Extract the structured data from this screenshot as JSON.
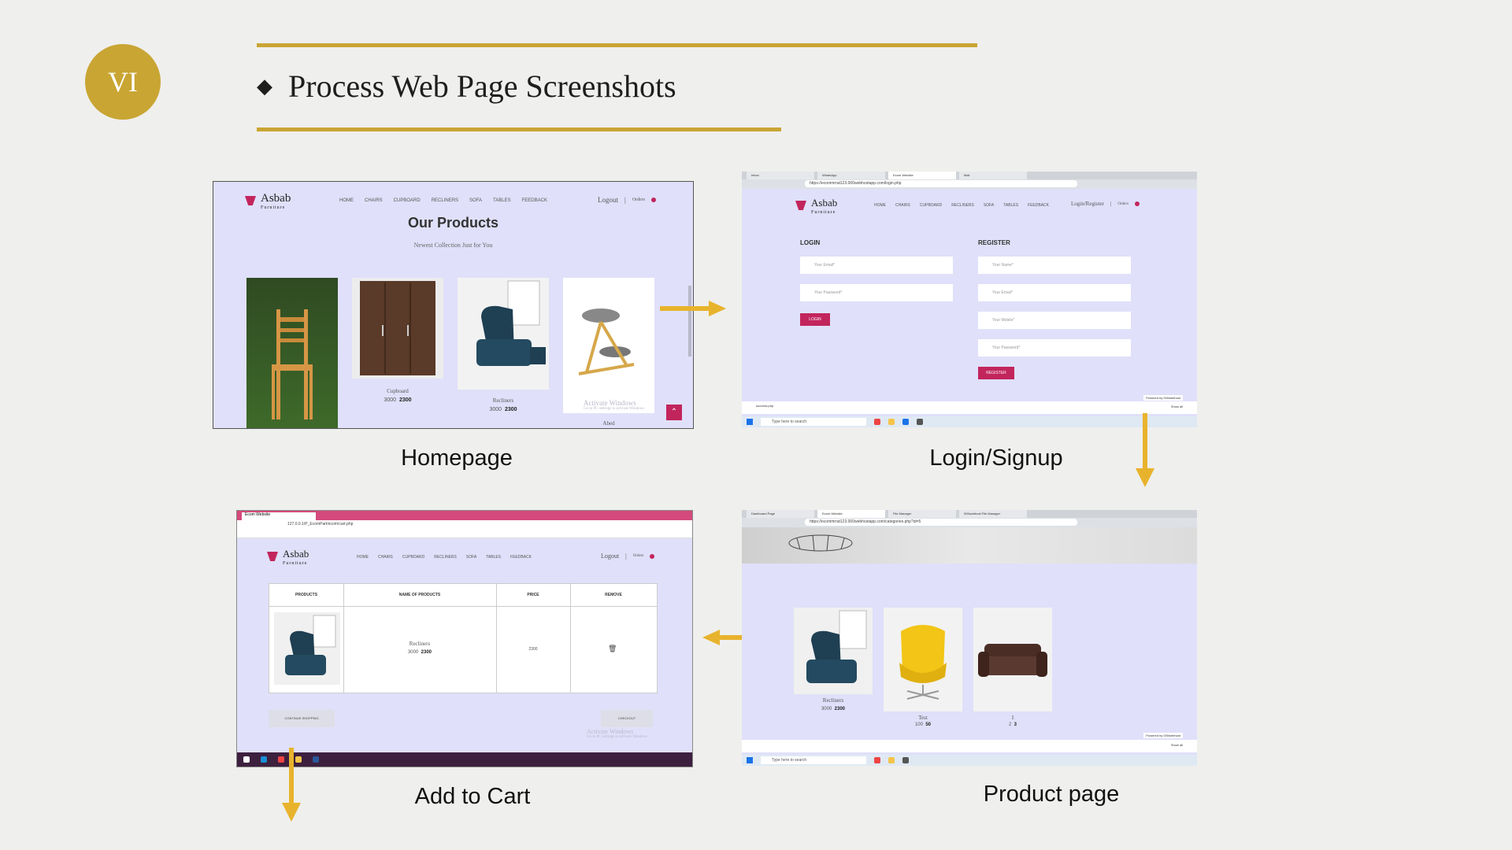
{
  "slide": {
    "badge": "VI",
    "title": "Process Web Page Screenshots",
    "accent_color": "#c9a533"
  },
  "captions": {
    "homepage": "Homepage",
    "login": "Login/Signup",
    "cart": "Add to Cart",
    "product": "Product page"
  },
  "site": {
    "logo": "Asbab",
    "logo_sub": "Furniture",
    "nav": [
      "HOME",
      "CHAIRS",
      "CUPBOARD",
      "RECLINERS",
      "SOFA",
      "TABLES",
      "FEEDBACK"
    ],
    "logout": "Logout",
    "orders": "Orders",
    "login_register": "Login/Register"
  },
  "homepage": {
    "heading": "Our Products",
    "subheading": "Newest Collection Just for You",
    "products": [
      {
        "name": "Cupboard",
        "old_price": "3000",
        "price": "2300"
      },
      {
        "name": "Recliners",
        "old_price": "3000",
        "price": "2300"
      },
      {
        "name": "Abed",
        "old_price": "",
        "price": ""
      }
    ],
    "watermark": "Activate Windows",
    "watermark_sub": "Go to PC settings to activate Windows"
  },
  "login_page": {
    "url": "https://ecommrrat123.000webhostapp.com/login.php",
    "login_title": "LOGIN",
    "register_title": "REGISTER",
    "email_placeholder": "Your Email*",
    "password_placeholder": "Your Password*",
    "name_placeholder": "Your Name*",
    "mobile_placeholder": "Your Mobile*",
    "login_button": "LOGIN",
    "register_button": "REGISTER",
    "powered": "Powered by 000webhost",
    "download": "success.php",
    "show_all": "Show all",
    "taskbar_search": "Type here to search"
  },
  "cart_page": {
    "url": "127.0.0.1/P_EcomPart/ecom/cart.php",
    "tab": "Ecom Website",
    "columns": [
      "PRODUCTS",
      "NAME OF PRODUCTS",
      "PRICE",
      "REMOVE"
    ],
    "item": {
      "name": "Recliners",
      "old_price": "3000",
      "price": "2300",
      "total": "2300"
    },
    "continue": "CONTINUE SHOPPING",
    "checkout": "CHECKOUT",
    "watermark": "Activate Windows",
    "watermark_sub": "Go to PC settings to activate Windows"
  },
  "product_page": {
    "url": "https://ecommrrat123.000webhostapp.com/categories.php?id=5",
    "tabs": [
      "Dashboard Page",
      "Ecom Website",
      "File Manager",
      "000webhost File Manager"
    ],
    "products": [
      {
        "name": "Recliners",
        "old_price": "3000",
        "price": "2300"
      },
      {
        "name": "Test",
        "old_price": "100",
        "price": "50"
      },
      {
        "name": "I",
        "old_price": "2",
        "price": "3"
      }
    ],
    "powered": "Powered by 000webhost",
    "show_all": "Show all",
    "taskbar_search": "Type here to search"
  }
}
